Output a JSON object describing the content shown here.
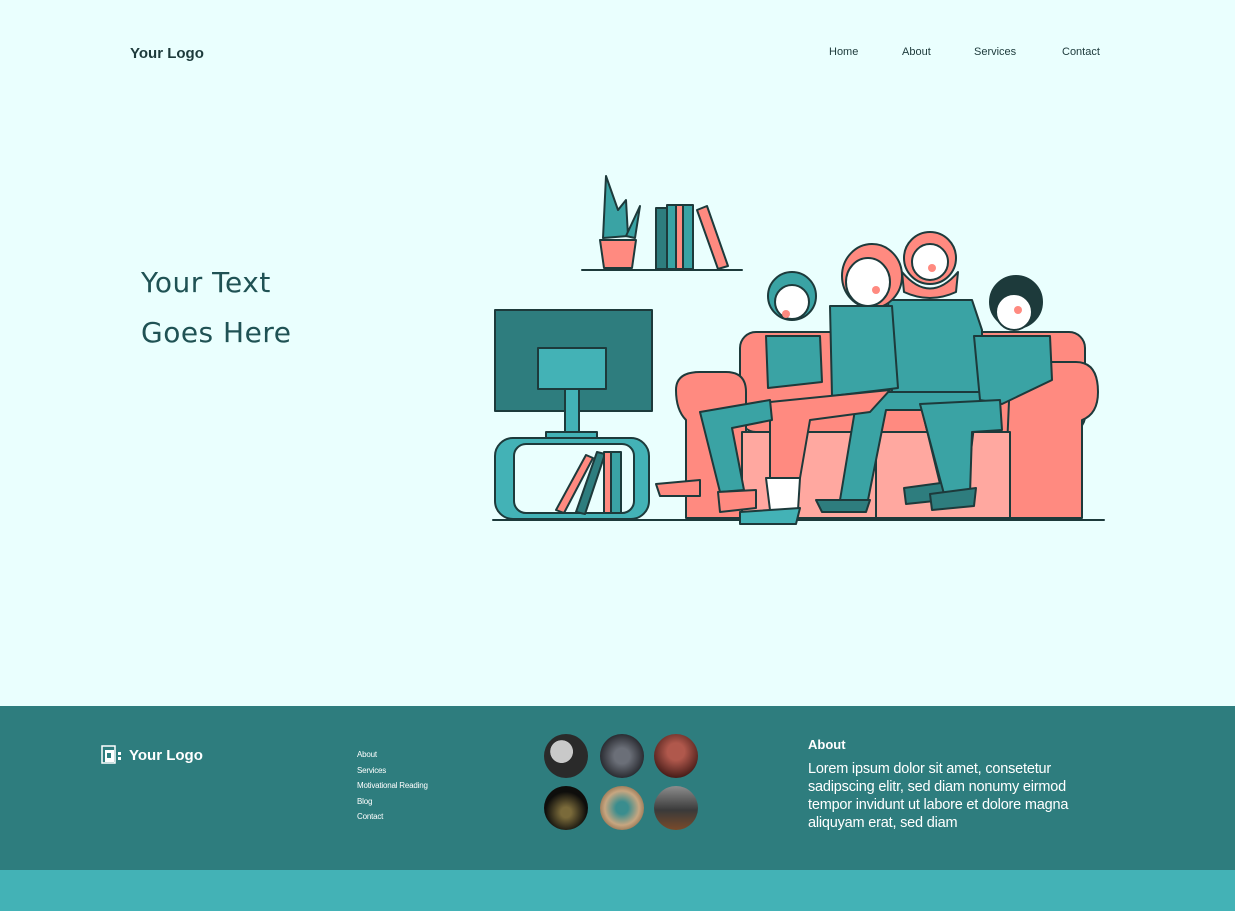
{
  "header": {
    "logo": "Your Logo",
    "nav": [
      "Home",
      "About",
      "Services",
      "Contact"
    ]
  },
  "hero": {
    "line1": "Your Text",
    "line2": "Goes Here",
    "illustration": "family-watching-tv-illustration"
  },
  "footer": {
    "logo": "Your Logo",
    "logo_icon": "document-icon",
    "links": [
      "About",
      "Services",
      "Motivational Reading",
      "Blog",
      "Contact"
    ],
    "gallery": [
      "gallery-photo-poster",
      "gallery-photo-crowd",
      "gallery-photo-audience",
      "gallery-photo-concert",
      "gallery-photo-speaker",
      "gallery-photo-hall"
    ],
    "about_title": "About",
    "about_text": "Lorem ipsum dolor sit amet, consetetur sadipscing elitr, sed diam nonumy eirmod tempor invidunt ut labore et dolore magna aliquyam erat, sed diam"
  },
  "colors": {
    "background": "#eafffe",
    "teal_dark": "#2e7d7e",
    "teal": "#43b2b6",
    "coral": "#ff8a80",
    "outline": "#1d3a3b"
  }
}
